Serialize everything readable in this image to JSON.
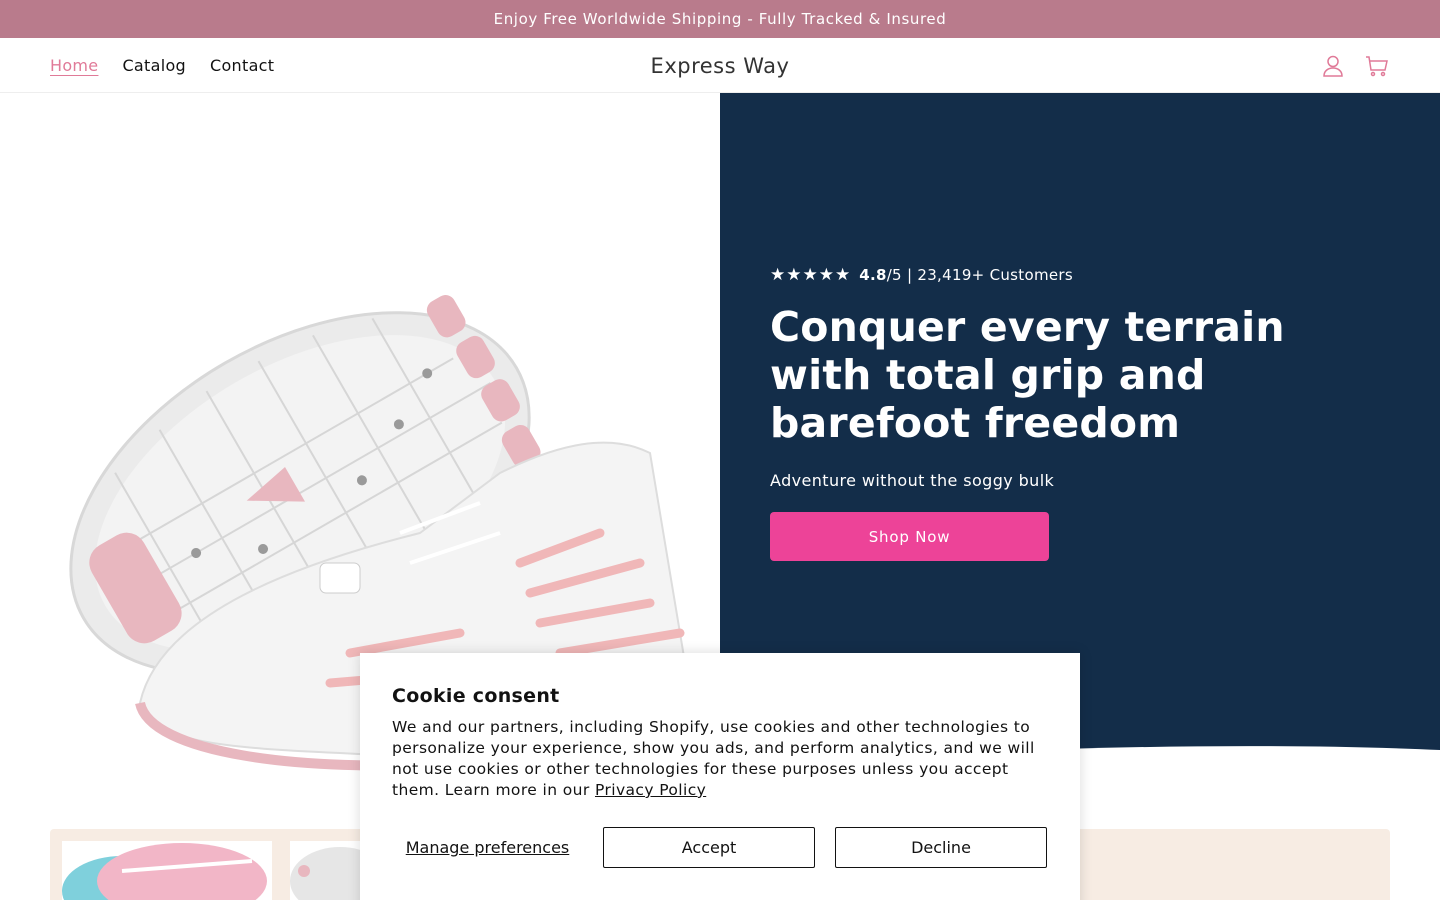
{
  "announcement": {
    "text": "Enjoy Free Worldwide Shipping - Fully Tracked & Insured"
  },
  "header": {
    "nav": [
      {
        "label": "Home",
        "active": true
      },
      {
        "label": "Catalog",
        "active": false
      },
      {
        "label": "Contact",
        "active": false
      }
    ],
    "brand": "Express Way",
    "icons": [
      "account-icon",
      "cart-icon"
    ]
  },
  "hero": {
    "rating": {
      "stars": "★★★★★",
      "score": "4.8",
      "suffix": "/5 | 23,419+ Customers"
    },
    "headline": "Conquer every terrain with total grip and barefoot freedom",
    "subline": "Adventure without the soggy bulk",
    "cta_label": "Shop Now"
  },
  "cookie": {
    "title": "Cookie consent",
    "text": "We and our partners, including Shopify, use cookies and other technologies to personalize your experience, show you ads, and perform analytics, and we will not use cookies or other technologies for these purposes unless you accept them. Learn more in our ",
    "privacy_link": "Privacy Policy",
    "manage_label": "Manage preferences",
    "accept_label": "Accept",
    "decline_label": "Decline"
  },
  "colors": {
    "announcement_bg": "#b97b8c",
    "hero_bg": "#132d49",
    "cta_bg": "#ed4398",
    "nav_active": "#e07a98"
  }
}
